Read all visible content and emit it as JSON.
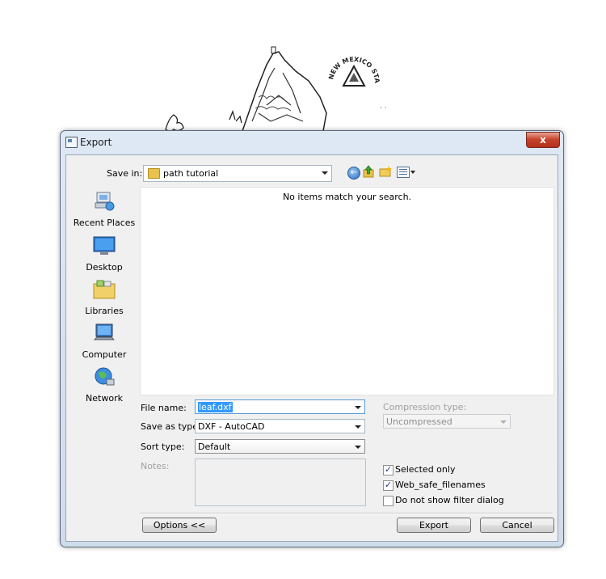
{
  "background": {
    "seal_text": "NEW MEXICO STATE UNIVERSITY"
  },
  "dialog": {
    "title": "Export",
    "close_glyph": "x",
    "save_in_label": "Save in:",
    "save_in_value": "path tutorial",
    "places": [
      {
        "label": "Recent Places",
        "icon": "recent-places-icon"
      },
      {
        "label": "Desktop",
        "icon": "desktop-icon"
      },
      {
        "label": "Libraries",
        "icon": "libraries-icon"
      },
      {
        "label": "Computer",
        "icon": "computer-icon"
      },
      {
        "label": "Network",
        "icon": "network-icon"
      }
    ],
    "empty_message": "No items match your search.",
    "file_name_label": "File name:",
    "file_name_value": "leaf.dxf",
    "save_as_type_label": "Save as type:",
    "save_as_type_value": "DXF - AutoCAD",
    "sort_type_label": "Sort type:",
    "sort_type_value": "Default",
    "notes_label": "Notes:",
    "compression_label": "Compression type:",
    "compression_value": "Uncompressed",
    "checkboxes": [
      {
        "label": "Selected only",
        "checked": true
      },
      {
        "label": "Web_safe_filenames",
        "checked": true
      },
      {
        "label": "Do not show filter dialog",
        "checked": false
      }
    ],
    "options_button": "Options <<",
    "export_button": "Export",
    "cancel_button": "Cancel"
  },
  "colors": {
    "close_button": "#c7452e",
    "selection": "#3399ff",
    "frame": "#dfe9f5"
  }
}
